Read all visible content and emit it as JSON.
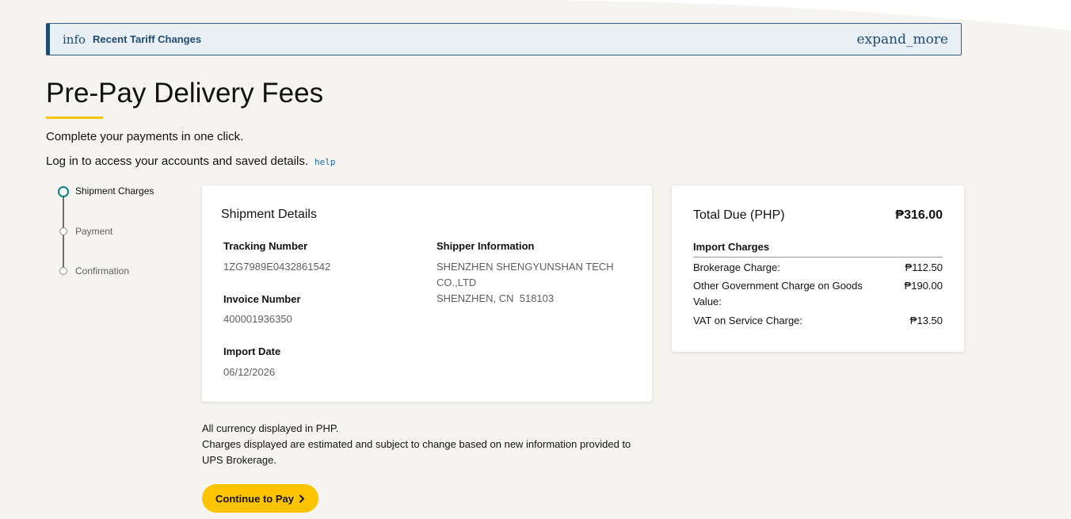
{
  "banner": {
    "icon": "info",
    "title": "Recent Tariff Changes",
    "expand_icon": "expand_more"
  },
  "header": {
    "title": "Pre-Pay Delivery Fees",
    "subtitle": "Complete your payments in one click.",
    "login_text": "Log in to access your accounts and saved details.",
    "help_icon": "help"
  },
  "stepper": {
    "steps": [
      {
        "label": "Shipment Charges",
        "state": "active"
      },
      {
        "label": "Payment",
        "state": "pending"
      },
      {
        "label": "Confirmation",
        "state": "pending"
      }
    ]
  },
  "shipment": {
    "heading": "Shipment Details",
    "tracking_label": "Tracking Number",
    "tracking_value": "1ZG7989E0432861542",
    "invoice_label": "Invoice Number",
    "invoice_value": "400001936350",
    "import_date_label": "Import Date",
    "import_date_value": "06/12/2026",
    "shipper_label": "Shipper Information",
    "shipper_lines": [
      "SHENZHEN SHENGYUNSHAN TECH",
      "CO.,LTD",
      "SHENZHEN, CN  518103"
    ]
  },
  "totals": {
    "heading": "Total Due (PHP)",
    "amount": "₱316.00",
    "charges_heading": "Import Charges",
    "charges": [
      {
        "label": "Brokerage Charge:",
        "value": "₱112.50"
      },
      {
        "label": "Other Government Charge on Goods Value:",
        "value": "₱190.00"
      },
      {
        "label": "VAT on Service Charge:",
        "value": "₱13.50"
      }
    ]
  },
  "notes": {
    "currency": "All currency displayed in PHP.",
    "disclaimer": "Charges displayed are estimated and subject to change based on new information provided to UPS Brokerage."
  },
  "actions": {
    "continue_label": "Continue to Pay"
  },
  "colors": {
    "accent": "#ffc400",
    "active_step": "#0a8080",
    "banner_text": "#1f4b73"
  }
}
